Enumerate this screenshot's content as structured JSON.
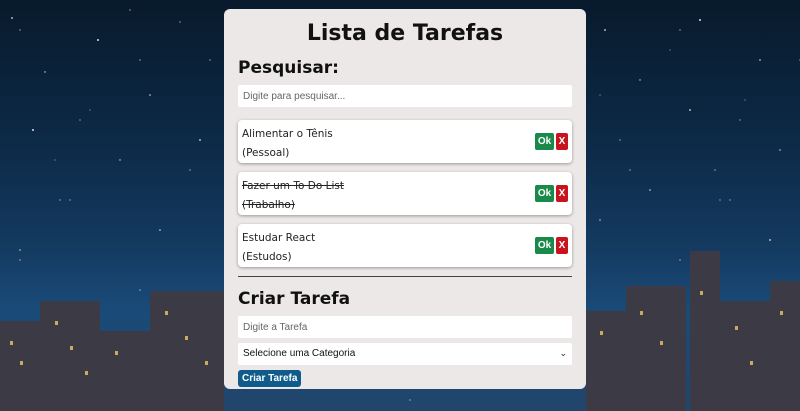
{
  "app": {
    "title": "Lista de Tarefas"
  },
  "search": {
    "heading": "Pesquisar:",
    "placeholder": "Digite para pesquisar..."
  },
  "todos": [
    {
      "text": "Alimentar o Tênis",
      "category": "(Pessoal)",
      "completed": false
    },
    {
      "text": "Fazer um To Do List",
      "category": "(Trabalho)",
      "completed": true
    },
    {
      "text": "Estudar React",
      "category": "(Estudos)",
      "completed": false
    }
  ],
  "buttons": {
    "ok_label": "Ok",
    "remove_label": "X"
  },
  "create": {
    "heading": "Criar Tarefa",
    "task_placeholder": "Digite a Tarefa",
    "category_selected": "Selecione uma Categoria",
    "submit_label": "Criar Tarefa"
  },
  "colors": {
    "card_bg": "#ede8e8",
    "ok_button": "#1a8a4a",
    "remove_button": "#c8141e",
    "create_button": "#0f5c8c"
  }
}
